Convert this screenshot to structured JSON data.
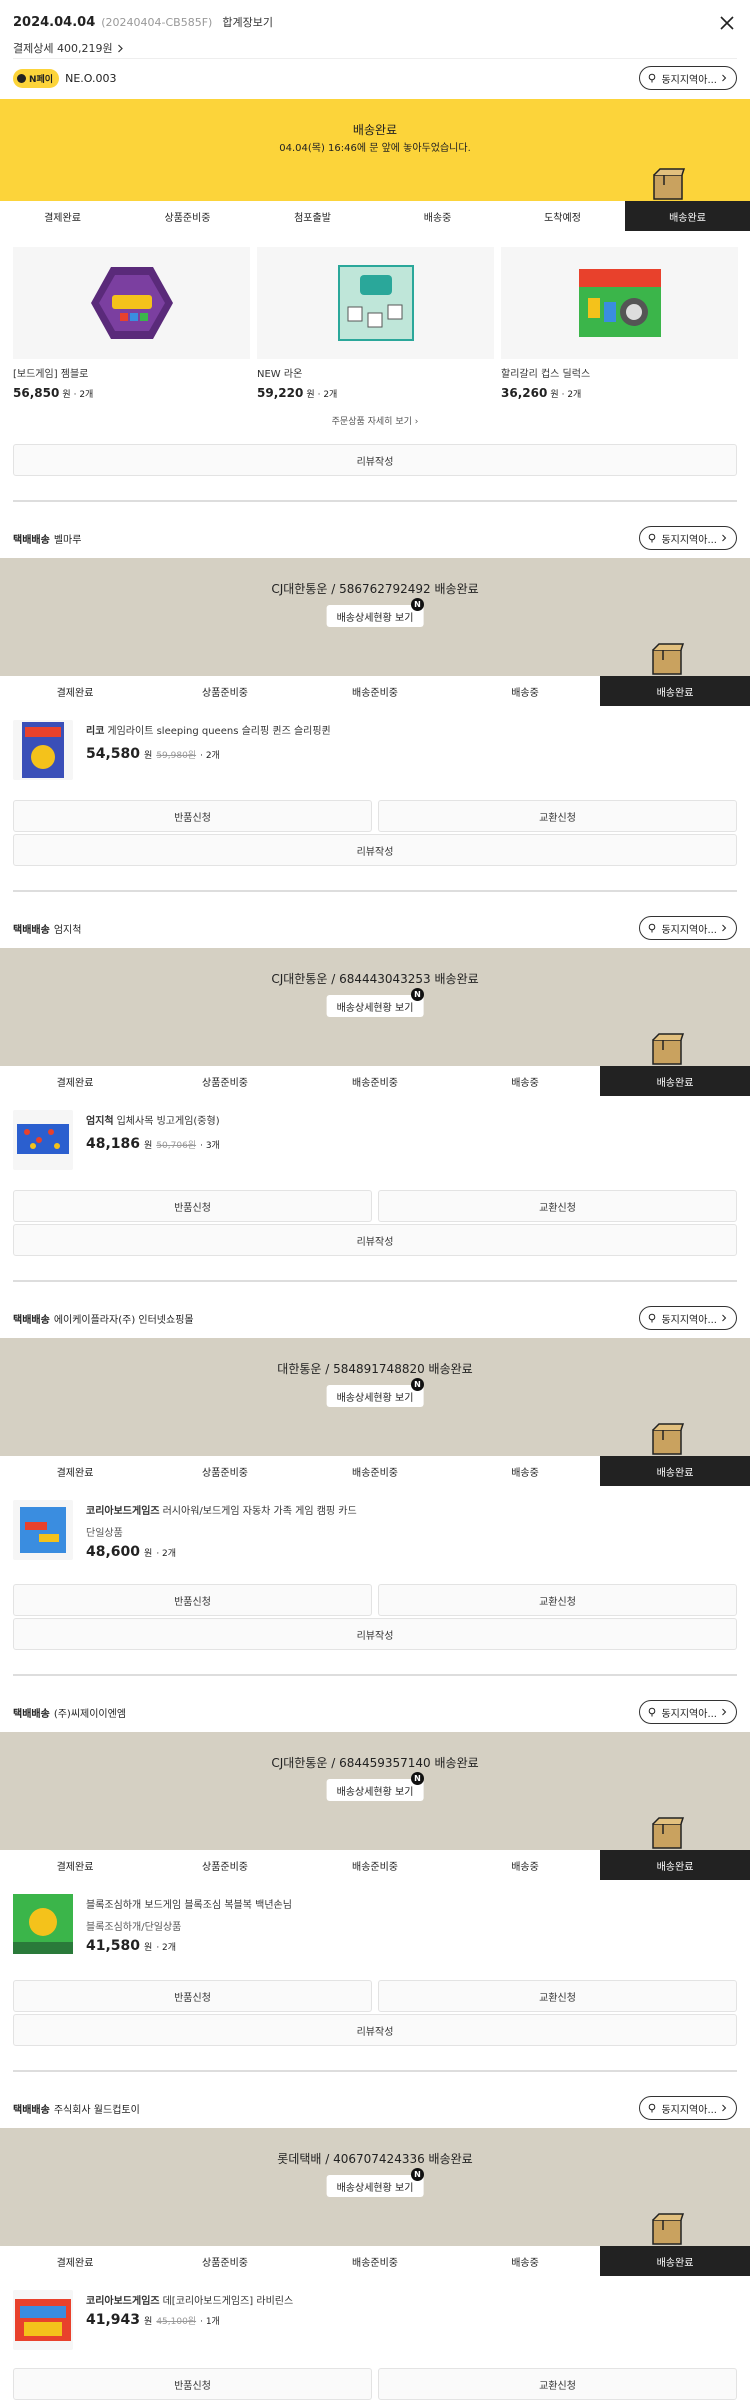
{
  "header": {
    "date": "2024.04.04",
    "order_no": "(20240404-CB585F)",
    "invoice_link": "합계장보기",
    "paid_label": "결제상세 400,219원",
    "seller_badge": "N페이",
    "seller_name": "NE.O.003",
    "nearby_label": "동지지역아..."
  },
  "colors": {
    "yellow": "#fcd43a",
    "beige": "#d5d0c3",
    "dark": "#222222"
  },
  "steps": [
    "결제완료",
    "상품준비중",
    "첨포출발",
    "배송중",
    "도착예정",
    "배송완료"
  ],
  "steps_b": [
    "결제완료",
    "상품준비중",
    "배송준비중",
    "배송중",
    "배송완료"
  ],
  "summary": {
    "status": "배송완료",
    "message": "04.04(목) 16:46에 문 앞에 놓아두었습니다.",
    "more_link": "주문상품 자세히 보기",
    "review": "리뷰작성",
    "products": [
      {
        "name": "[보드게임] 젬블로",
        "price": "56,850",
        "unit": "원",
        "qty": "· 2개"
      },
      {
        "name": "NEW 라온",
        "price": "59,220",
        "unit": "원",
        "qty": "· 2개"
      },
      {
        "name": "할리갈리 컵스 딜럭스",
        "price": "36,260",
        "unit": "원",
        "qty": "· 2개"
      }
    ]
  },
  "labels": {
    "return": "반품신청",
    "exchange": "교환신청",
    "review": "리뷰작성",
    "detail": "배송상세현황 보기",
    "new": "N",
    "parcel": "택배배송"
  },
  "shipments": [
    {
      "seller": "벨마루",
      "carrier": "CJ대한통운 / 586762792492 배송완료",
      "brand": "리코",
      "product": "게임라이트 sleeping queens 슬리핑 퀸즈 슬리핑퀸",
      "option": "",
      "price": "54,580",
      "unit": "원",
      "orig": "59,980원",
      "qty": "· 2개"
    },
    {
      "seller": "엄지척",
      "carrier": "CJ대한통운 / 684443043253 배송완료",
      "brand": "엄지척",
      "product": "입체사목 빙고게임(중형)",
      "option": "",
      "price": "48,186",
      "unit": "원",
      "orig": "50,706원",
      "qty": "· 3개"
    },
    {
      "seller": "에이케이플라자(주) 인터넷쇼핑몰",
      "carrier": "대한통운 / 584891748820 배송완료",
      "brand": "코리아보드게임즈",
      "product": "러시아워/보드게임 자동차 가족 게임 캠핑 카드",
      "option": "단일상품",
      "price": "48,600",
      "unit": "원",
      "orig": "",
      "qty": "· 2개"
    },
    {
      "seller": "(주)씨제이이엔엠",
      "carrier": "CJ대한통운 / 684459357140 배송완료",
      "brand": "",
      "product": "블록조심하개 보드게임 블록조심 복블복 백년손님",
      "option": "블록조심하개/단일상품",
      "price": "41,580",
      "unit": "원",
      "orig": "",
      "qty": "· 2개"
    },
    {
      "seller": "주식회사 월드컵토이",
      "carrier": "롯데택배 / 406707424336 배송완료",
      "brand": "코리아보드게임즈",
      "product": "데[코리아보드게임즈] 라비린스",
      "option": "",
      "price": "41,943",
      "unit": "원",
      "orig": "45,100원",
      "qty": "· 1개"
    }
  ]
}
